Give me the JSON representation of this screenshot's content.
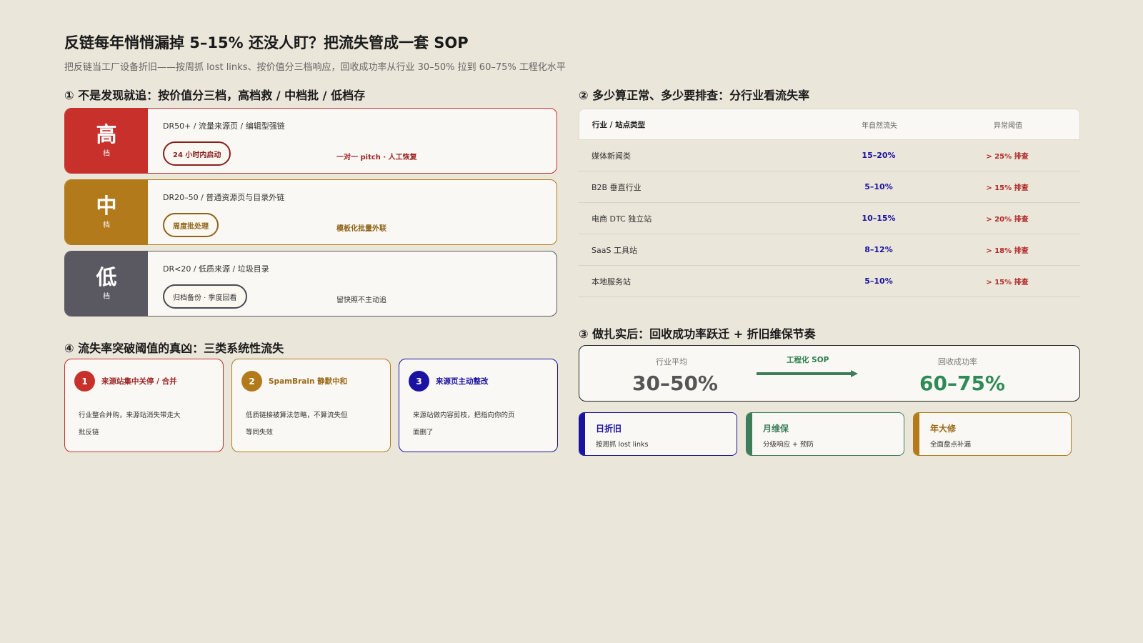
{
  "header": {
    "title": "反链每年悄悄漏掉 5–15% 还没人盯？把流失管成一套 SOP",
    "subtitle": "把反链当工厂设备折旧——按周抓 lost links、按价值分三档响应，回收成功率从行业 30–50% 拉到 60–75% 工程化水平"
  },
  "section1": {
    "title": "① 不是发现就追：按价值分三档，高档救 / 中档批 / 低档存",
    "tiers": [
      {
        "big": "高",
        "small": "档",
        "desc": "DR50+ / 流量来源页 / 编辑型强链",
        "pill": "24 小时内启动",
        "action": "一对一 pitch · 人工恢复",
        "color": "#c8302c"
      },
      {
        "big": "中",
        "small": "档",
        "desc": "DR20–50 / 普通资源页与目录外链",
        "pill": "周度批处理",
        "action": "模板化批量外联",
        "color": "#b37a1c"
      },
      {
        "big": "低",
        "small": "档",
        "desc": "DR<20 / 低质来源 / 垃圾目录",
        "pill": "归档备份 · 季度回看",
        "action": "留快照不主动追",
        "color": "#5a5860"
      }
    ]
  },
  "section2": {
    "title": "② 多少算正常、多少要排查：分行业看流失率",
    "headers": [
      "行业 / 站点类型",
      "年自然流失",
      "异常阈值"
    ],
    "rows": [
      [
        "媒体新闻类",
        "15–20%",
        "> 25% 排查"
      ],
      [
        "B2B 垂直行业",
        "5–10%",
        "> 15% 排查"
      ],
      [
        "电商 DTC 独立站",
        "10–15%",
        "> 20% 排查"
      ],
      [
        "SaaS 工具站",
        "8–12%",
        "> 18% 排查"
      ],
      [
        "本地服务站",
        "5–10%",
        "> 15% 排查"
      ]
    ]
  },
  "section3": {
    "title": "③ 做扎实后：回收成功率跃迁 + 折旧维保节奏",
    "before_label": "行业平均",
    "before_value": "30–50%",
    "sop_label": "工程化 SOP",
    "after_label": "回收成功率",
    "after_value": "60–75%",
    "cadence": [
      {
        "title": "日折旧",
        "sub": "按周抓 lost links",
        "color": "#1a12a0"
      },
      {
        "title": "月维保",
        "sub": "分级响应 + 预防",
        "color": "#3e7d5a"
      },
      {
        "title": "年大修",
        "sub": "全面盘点补漏",
        "color": "#b37a1c"
      }
    ]
  },
  "section4": {
    "title": "④ 流失率突破阈值的真凶：三类系统性流失",
    "causes": [
      {
        "num": "1",
        "title": "来源站集中关停 / 合并",
        "body": "行业整合并购，来源站消失带走大批反链",
        "color": "#c8302c"
      },
      {
        "num": "2",
        "title": "SpamBrain 静默中和",
        "body": "低质链接被算法忽略，不算流失但等同失效",
        "color": "#b37a1c"
      },
      {
        "num": "3",
        "title": "来源页主动整改",
        "body": "来源站做内容剪枝，把指向你的页面删了",
        "color": "#1a12a0"
      }
    ]
  }
}
